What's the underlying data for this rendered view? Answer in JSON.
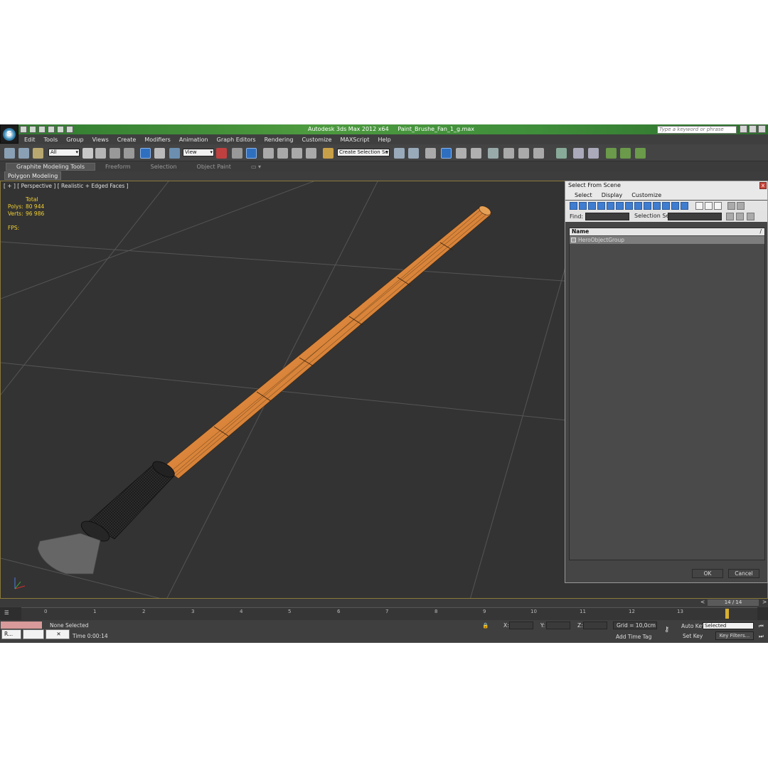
{
  "app": {
    "title": "Autodesk 3ds Max  2012 x64",
    "filename": "Paint_Brushe_Fan_1_g.max",
    "search_placeholder": "Type a keyword or phrase",
    "logo_letter": "S"
  },
  "menu": [
    "Edit",
    "Tools",
    "Group",
    "Views",
    "Create",
    "Modifiers",
    "Animation",
    "Graph Editors",
    "Rendering",
    "Customize",
    "MAXScript",
    "Help"
  ],
  "toolbar": {
    "filter_value": "All",
    "refcoord_value": "View",
    "selection_set_placeholder": "Create Selection Se"
  },
  "ribbon": {
    "tabs": [
      "Graphite Modeling Tools",
      "Freeform",
      "Selection",
      "Object Paint"
    ],
    "panel_label": "Polygon Modeling"
  },
  "viewport": {
    "label": "[ + ] [ Perspective ] [ Realistic + Edged Faces ]",
    "stats_header": "Total",
    "polys_label": "Polys:",
    "polys_value": "80 944",
    "verts_label": "Verts:",
    "verts_value": "96 986",
    "fps_label": "FPS:"
  },
  "dialog": {
    "title": "Select From Scene",
    "close": "x",
    "menu": [
      "Select",
      "Display",
      "Customize"
    ],
    "find_label": "Find:",
    "selection_set_label": "Selection Set:",
    "column_name": "Name",
    "items": [
      "HeroObjectGroup"
    ],
    "ok_label": "OK",
    "cancel_label": "Cancel"
  },
  "timeline": {
    "frame_counter": "14 / 14",
    "ticks": [
      "0",
      "1",
      "2",
      "3",
      "4",
      "5",
      "6",
      "7",
      "8",
      "9",
      "10",
      "11",
      "12",
      "13"
    ],
    "nav_left": "<",
    "nav_right": ">"
  },
  "status": {
    "selection": "None Selected",
    "time_label": "Time  0:00:14",
    "x_label": "X:",
    "y_label": "Y:",
    "z_label": "Z:",
    "grid": "Grid = 10,0cm",
    "add_time_tag": "Add Time Tag",
    "auto_key": "Auto Key",
    "auto_key_value": "Selected",
    "set_key": "Set Key",
    "key_filters": "Key Filters...",
    "taskbar_r": "R..."
  }
}
